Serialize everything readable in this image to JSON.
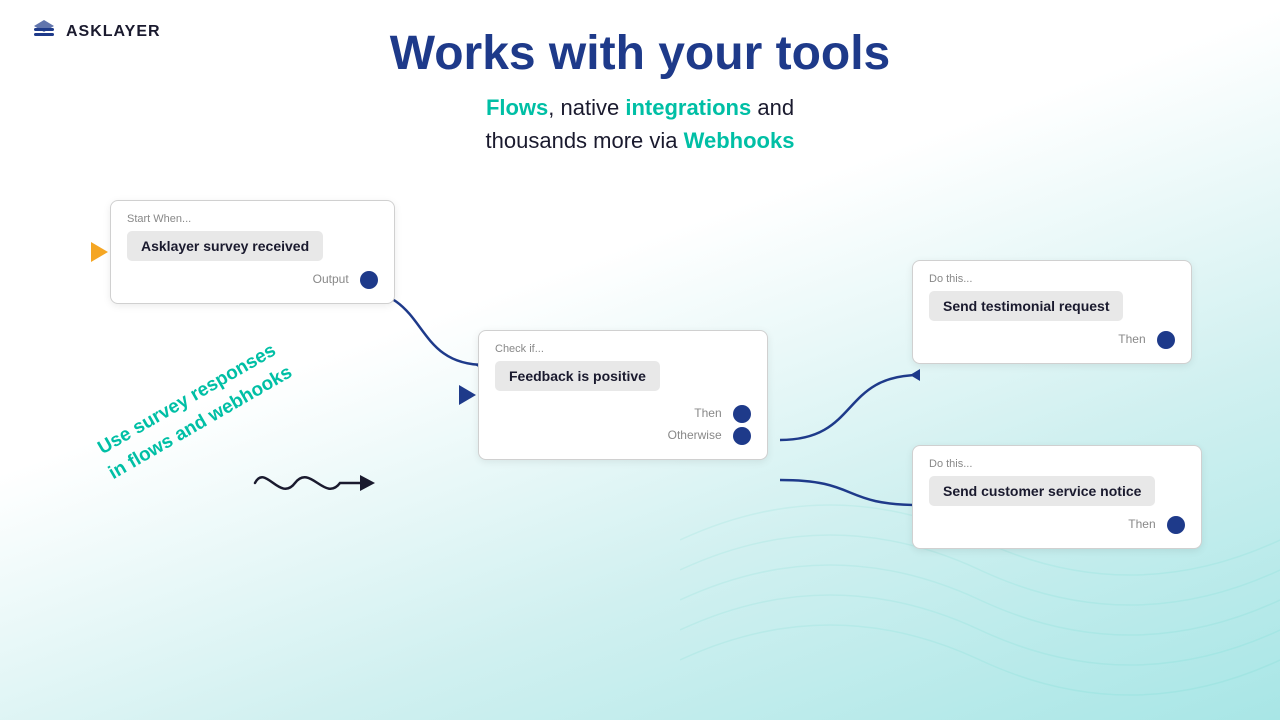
{
  "logo": {
    "text": "ASKLAYER"
  },
  "header": {
    "title": "Works with your tools",
    "subtitle_part1": "Flows",
    "subtitle_part2": ", native ",
    "subtitle_part3": "integrations",
    "subtitle_part4": " and\nthousands more via ",
    "subtitle_part5": "Webhooks"
  },
  "nodes": {
    "start": {
      "label": "Start When...",
      "content": "Asklayer survey received",
      "output_label": "Output"
    },
    "check": {
      "label": "Check if...",
      "content": "Feedback is positive",
      "then_label": "Then",
      "otherwise_label": "Otherwise"
    },
    "do_top": {
      "label": "Do this...",
      "content": "Send testimonial request",
      "then_label": "Then"
    },
    "do_bottom": {
      "label": "Do this...",
      "content": "Send customer service notice",
      "then_label": "Then"
    }
  },
  "diagonal_text": {
    "line1": "Use survey responses",
    "line2": "in flows and webhooks"
  },
  "colors": {
    "blue_dark": "#1e3a8a",
    "teal": "#00bfa5",
    "dot_blue": "#1e3a8a",
    "orange": "#f5a623"
  }
}
